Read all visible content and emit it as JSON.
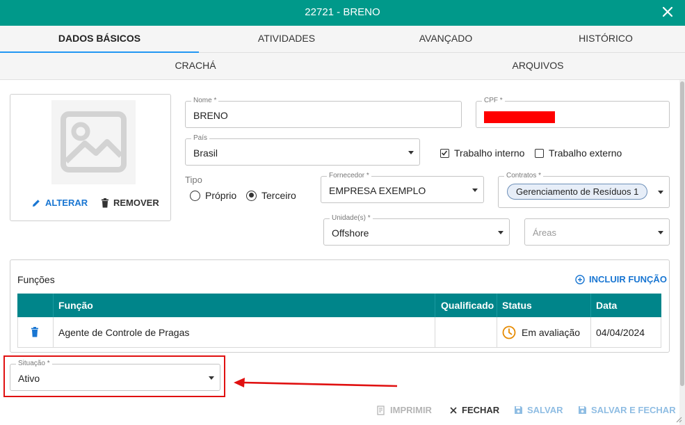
{
  "window": {
    "title": "22721 - BRENO"
  },
  "tabs_primary": [
    {
      "label": "DADOS BÁSICOS",
      "active": true
    },
    {
      "label": "ATIVIDADES",
      "active": false
    },
    {
      "label": "AVANÇADO",
      "active": false
    },
    {
      "label": "HISTÓRICO",
      "active": false
    }
  ],
  "tabs_secondary": [
    {
      "label": "CRACHÁ"
    },
    {
      "label": "ARQUIVOS"
    }
  ],
  "photo": {
    "alter_label": "ALTERAR",
    "remove_label": "REMOVER"
  },
  "form": {
    "nome": {
      "label": "Nome *",
      "value": "BRENO"
    },
    "cpf": {
      "label": "CPF *"
    },
    "pais": {
      "label": "País",
      "value": "Brasil"
    },
    "trabalho_interno": {
      "label": "Trabalho interno",
      "checked": true
    },
    "trabalho_externo": {
      "label": "Trabalho externo",
      "checked": false
    },
    "tipo": {
      "label": "Tipo",
      "options": [
        {
          "label": "Próprio",
          "selected": false
        },
        {
          "label": "Terceiro",
          "selected": true
        }
      ]
    },
    "fornecedor": {
      "label": "Fornecedor *",
      "value": "EMPRESA EXEMPLO"
    },
    "contratos": {
      "label": "Contratos *",
      "chip": "Gerenciamento de Resíduos 1"
    },
    "unidades": {
      "label": "Unidade(s) *",
      "value": "Offshore"
    },
    "areas": {
      "placeholder": "Áreas"
    },
    "situacao": {
      "label": "Situação *",
      "value": "Ativo"
    }
  },
  "functions": {
    "heading": "Funções",
    "add_label": "INCLUIR FUNÇÃO",
    "columns": [
      "Função",
      "Qualificado",
      "Status",
      "Data"
    ],
    "rows": [
      {
        "funcao": "Agente de Controle de Pragas",
        "qualificado": "",
        "status": "Em avaliação",
        "data": "04/04/2024"
      }
    ]
  },
  "footer": {
    "imprimir": "IMPRIMIR",
    "fechar": "FECHAR",
    "salvar": "SALVAR",
    "salvar_fechar": "SALVAR E FECHAR"
  },
  "colors": {
    "header": "#00998a",
    "table_header": "#00858a",
    "accent": "#1976d2",
    "highlight": "#e01010",
    "status_pending": "#e68a00"
  },
  "icons": [
    "close-icon",
    "image-placeholder-icon",
    "pencil-icon",
    "trash-icon",
    "plus-circle-icon",
    "clock-icon",
    "print-icon",
    "save-icon"
  ]
}
